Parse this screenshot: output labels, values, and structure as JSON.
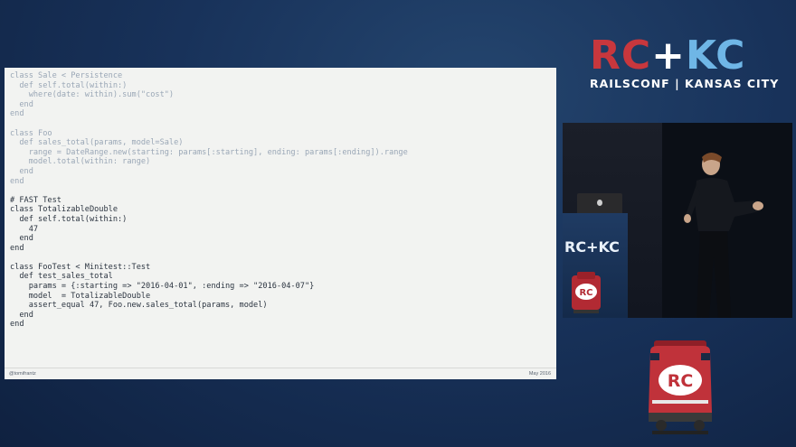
{
  "slide": {
    "code_lines": [
      {
        "text": "class Sale < Persistence",
        "style": "dim"
      },
      {
        "text": "  def self.total(within:)",
        "style": "dim"
      },
      {
        "text": "    where(date: within).sum(\"cost\")",
        "style": "dim"
      },
      {
        "text": "  end",
        "style": "dim"
      },
      {
        "text": "end",
        "style": "dim"
      },
      {
        "text": "",
        "style": "dim"
      },
      {
        "text": "class Foo",
        "style": "dim"
      },
      {
        "text": "  def sales_total(params, model=Sale)",
        "style": "dim"
      },
      {
        "text": "    range = DateRange.new(starting: params[:starting], ending: params[:ending]).range",
        "style": "dim"
      },
      {
        "text": "    model.total(within: range)",
        "style": "dim"
      },
      {
        "text": "  end",
        "style": "dim"
      },
      {
        "text": "end",
        "style": "dim"
      },
      {
        "text": "",
        "style": "dim"
      },
      {
        "text": "# FAST Test",
        "style": "full"
      },
      {
        "text": "class TotalizableDouble",
        "style": "full"
      },
      {
        "text": "  def self.total(within:)",
        "style": "full"
      },
      {
        "text": "    47",
        "style": "full"
      },
      {
        "text": "  end",
        "style": "full"
      },
      {
        "text": "end",
        "style": "full"
      },
      {
        "text": "",
        "style": "full"
      },
      {
        "text": "class FooTest < Minitest::Test",
        "style": "full"
      },
      {
        "text": "  def test_sales_total",
        "style": "full"
      },
      {
        "text": "    params = {:starting => \"2016-04-01\", :ending => \"2016-04-07\"}",
        "style": "full"
      },
      {
        "text": "    model  = TotalizableDouble",
        "style": "full"
      },
      {
        "text": "    assert_equal 47, Foo.new.sales_total(params, model)",
        "style": "full"
      },
      {
        "text": "  end",
        "style": "full"
      },
      {
        "text": "end",
        "style": "full"
      }
    ],
    "footer_left": "@tomifrantz",
    "footer_right": "May 2016"
  },
  "logo": {
    "rc": "RC",
    "plus": "+",
    "kc": "KC",
    "subtitle": "RAILSCONF | KANSAS CITY"
  },
  "video": {
    "podium_text": "RC+KC",
    "mini_train_text": "RC"
  },
  "train": {
    "text": "RC"
  },
  "colors": {
    "logo_red": "#c8373d",
    "logo_blue": "#6fb6e6",
    "code_dim": "#9aa7b6",
    "code_full": "#2b3440"
  }
}
